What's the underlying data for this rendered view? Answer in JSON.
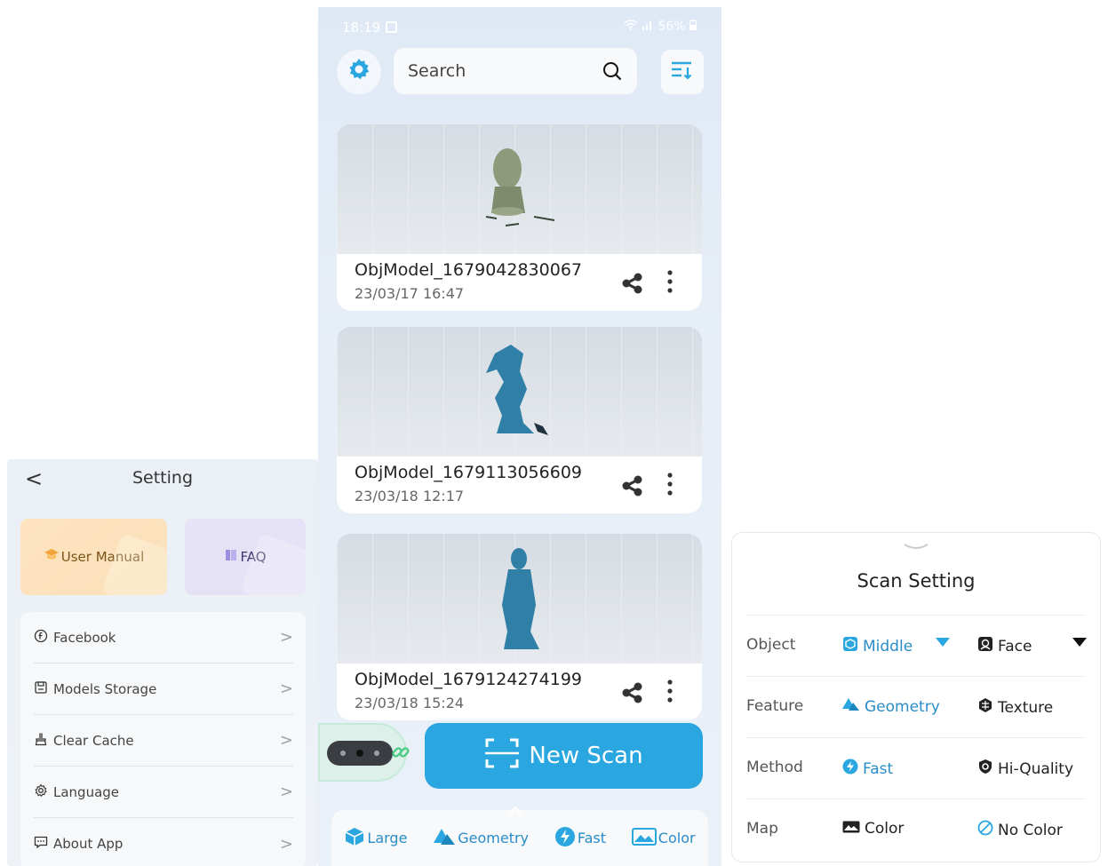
{
  "setting": {
    "back": "<",
    "title": "Setting",
    "cards": [
      {
        "label": "User Manual",
        "icon": "graduation-cap-icon"
      },
      {
        "label": "FAQ",
        "icon": "book-icon"
      }
    ],
    "menu": [
      {
        "label": "Facebook",
        "icon": "facebook-icon"
      },
      {
        "label": "Models Storage",
        "icon": "storage-icon"
      },
      {
        "label": "Clear Cache",
        "icon": "broom-icon"
      },
      {
        "label": "Language",
        "icon": "gear-icon"
      },
      {
        "label": "About App",
        "icon": "message-icon"
      }
    ],
    "chevron": ">"
  },
  "phone": {
    "status": {
      "time": "18:19",
      "battery": "56%"
    },
    "search": {
      "placeholder": "Search"
    },
    "models": [
      {
        "name": "ObjModel_1679042830067",
        "date": "23/03/17 16:47",
        "preview": "bust"
      },
      {
        "name": "ObjModel_1679113056609",
        "date": "23/03/18 12:17",
        "preview": "horse"
      },
      {
        "name": "ObjModel_1679124274199",
        "date": "23/03/18 15:24",
        "preview": "warrior"
      }
    ],
    "new_scan": "New Scan",
    "bottom": [
      {
        "label": "Large",
        "icon": "cube-icon"
      },
      {
        "label": "Geometry",
        "icon": "geometry-icon"
      },
      {
        "label": "Fast",
        "icon": "bolt-icon"
      },
      {
        "label": "Color",
        "icon": "color-map-icon"
      }
    ]
  },
  "scan_setting": {
    "title": "Scan Setting",
    "rows": [
      {
        "label": "Object",
        "opt1": "Middle",
        "opt2": "Face",
        "selected": 1
      },
      {
        "label": "Feature",
        "opt1": "Geometry",
        "opt2": "Texture",
        "selected": 1
      },
      {
        "label": "Method",
        "opt1": "Fast",
        "opt2": "Hi-Quality",
        "selected": 1
      },
      {
        "label": "Map",
        "opt1": "Color",
        "opt2": "No Color",
        "selected": 2
      }
    ]
  },
  "colors": {
    "accent": "#2aa7e0",
    "accent_text": "#2a8cc7"
  }
}
